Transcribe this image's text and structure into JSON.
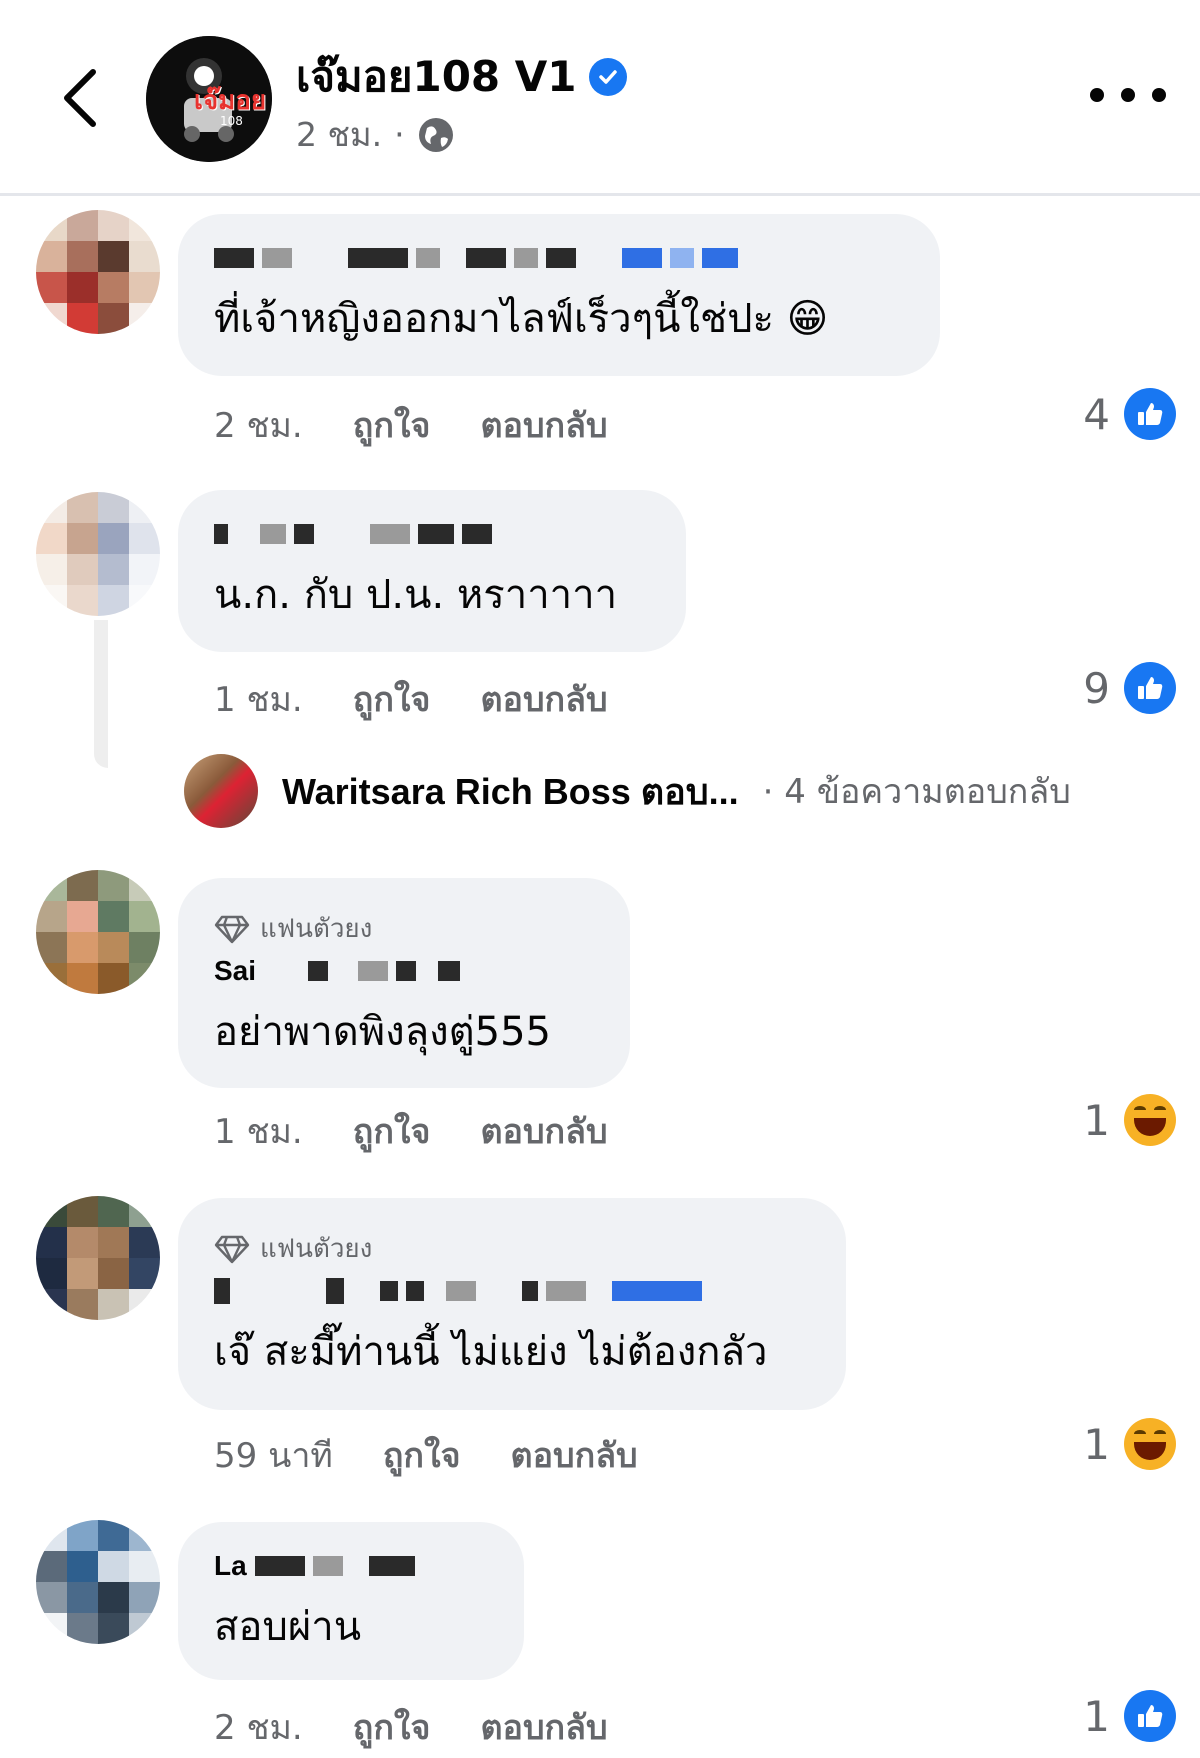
{
  "header": {
    "page_name": "เจ๊มอย108 V1",
    "time": "2 ชม.",
    "separator": "·",
    "avatar_logo": "เจ๊มอย",
    "avatar_logo_sub": "108"
  },
  "comments": [
    {
      "text": "ที่เจ้าหญิงออกมาไลฟ์เร็วๆนี้ใช่ปะ 😁",
      "time": "2 ชม.",
      "like_label": "ถูกใจ",
      "reply_label": "ตอบกลับ",
      "reaction_count": "4",
      "reaction_type": "like-icon"
    },
    {
      "text": "น.ก. กับ ป.น. หราาาาา",
      "time": "1 ชม.",
      "like_label": "ถูกใจ",
      "reply_label": "ตอบกลับ",
      "reaction_count": "9",
      "reaction_type": "like-icon"
    },
    {
      "badge": "แฟนตัวยง",
      "author_partial": "Sai",
      "text": "อย่าพาดพิงลุงตู่555",
      "time": "1 ชม.",
      "like_label": "ถูกใจ",
      "reply_label": "ตอบกลับ",
      "reaction_count": "1",
      "reaction_type": "haha-icon"
    },
    {
      "badge": "แฟนตัวยง",
      "text": "เจ๊ สะมี๊ท่านนี้ ไม่แย่ง ไม่ต้องกลัว",
      "time": "59 นาที",
      "like_label": "ถูกใจ",
      "reply_label": "ตอบกลับ",
      "reaction_count": "1",
      "reaction_type": "haha-icon"
    },
    {
      "author_partial": "La",
      "text": "สอบผ่าน",
      "time": "2 ชม.",
      "like_label": "ถูกใจ",
      "reply_label": "ตอบกลับ",
      "reaction_count": "1",
      "reaction_type": "like-icon"
    }
  ],
  "reply_summary": {
    "name": "Waritsara Rich Boss ตอบ...",
    "count_text": "· 4 ข้อความตอบกลับ"
  },
  "colors": {
    "accent": "#1877f2",
    "bubble": "#f0f2f5",
    "secondary_text": "#65676b"
  }
}
